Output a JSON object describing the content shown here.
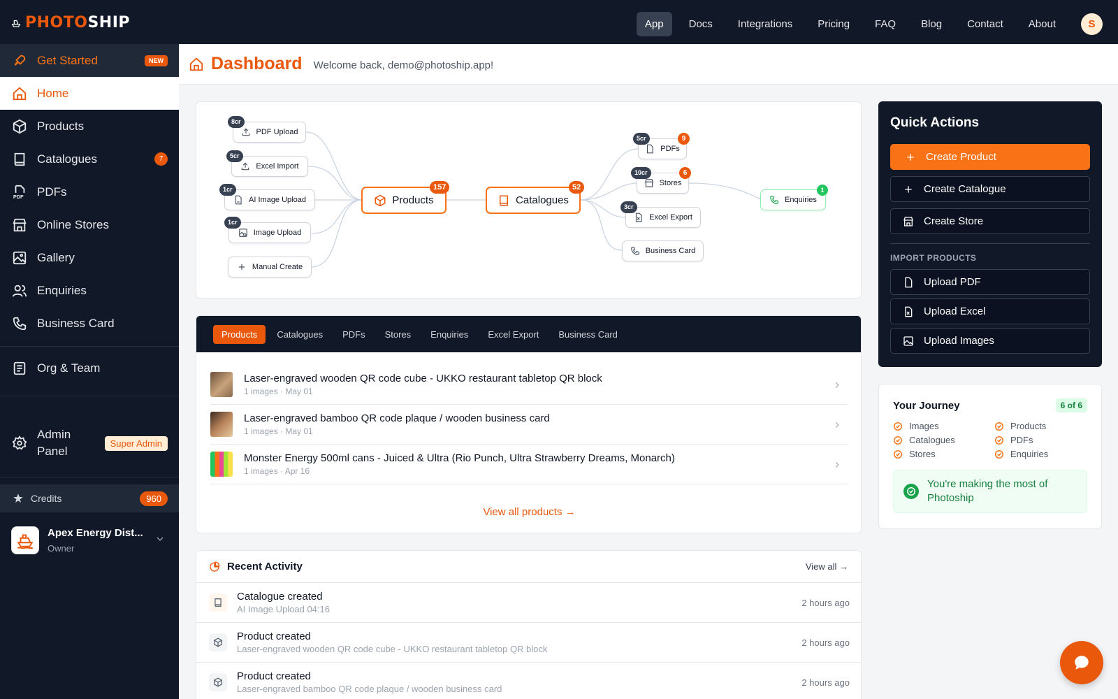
{
  "brand": {
    "part1": "PHOTO",
    "part2": "SHIP",
    "accent": "#ea580c",
    "dark": "#111827"
  },
  "topnav": {
    "items": [
      "App",
      "Docs",
      "Integrations",
      "Pricing",
      "FAQ",
      "Blog",
      "Contact",
      "About"
    ],
    "active": "App",
    "avatar_initial": "S"
  },
  "sidebar": {
    "get_started": {
      "label": "Get Started",
      "badge": "NEW"
    },
    "items": [
      {
        "label": "Home",
        "icon": "home-icon"
      },
      {
        "label": "Products",
        "icon": "cube-icon"
      },
      {
        "label": "Catalogues",
        "icon": "book-icon",
        "badge": "7"
      },
      {
        "label": "PDFs",
        "icon": "pdf-icon"
      },
      {
        "label": "Online Stores",
        "icon": "store-icon"
      },
      {
        "label": "Gallery",
        "icon": "image-icon"
      },
      {
        "label": "Enquiries",
        "icon": "users-icon"
      },
      {
        "label": "Business Card",
        "icon": "phone-icon"
      }
    ],
    "org_team": "Org & Team",
    "admin": {
      "label": "Admin Panel",
      "badge": "Super Admin"
    },
    "credits": {
      "label": "Credits",
      "value": "960"
    },
    "org": {
      "name": "Apex Energy Dist...",
      "role": "Owner"
    }
  },
  "header": {
    "title": "Dashboard",
    "welcome": "Welcome back, demo@photoship.app!"
  },
  "flow": {
    "inputs": [
      {
        "label": "PDF Upload",
        "cost": "8cr"
      },
      {
        "label": "Excel Import",
        "cost": "5cr"
      },
      {
        "label": "AI Image Upload",
        "cost": "1cr"
      },
      {
        "label": "Image Upload",
        "cost": "1cr"
      },
      {
        "label": "Manual Create",
        "cost": ""
      }
    ],
    "products": {
      "label": "Products",
      "count": "157"
    },
    "catalogues": {
      "label": "Catalogues",
      "count": "52"
    },
    "outputs": [
      {
        "label": "PDFs",
        "cost": "5cr",
        "count": "9"
      },
      {
        "label": "Stores",
        "cost": "10cr",
        "count": "6"
      },
      {
        "label": "Excel Export",
        "cost": "3cr"
      },
      {
        "label": "Business Card",
        "cost": ""
      }
    ],
    "enquiries": {
      "label": "Enquiries",
      "count": "1"
    }
  },
  "tabs": {
    "items": [
      "Products",
      "Catalogues",
      "PDFs",
      "Stores",
      "Enquiries",
      "Excel Export",
      "Business Card"
    ],
    "active": "Products",
    "products": [
      {
        "title": "Laser-engraved wooden QR code cube - UKKO restaurant tabletop QR block",
        "meta": "1 images · May 01"
      },
      {
        "title": "Laser-engraved bamboo QR code plaque / wooden business card",
        "meta": "1 images · May 01"
      },
      {
        "title": "Monster Energy 500ml cans - Juiced & Ultra (Rio Punch, Ultra Strawberry Dreams, Monarch)",
        "meta": "1 images · Apr 16"
      }
    ],
    "view_all": "View all products →"
  },
  "activity": {
    "title": "Recent Activity",
    "view_all": "View all →",
    "rows": [
      {
        "title": "Catalogue created",
        "sub": "AI Image Upload 04:16",
        "time": "2 hours ago",
        "icon": "book-icon"
      },
      {
        "title": "Product created",
        "sub": "Laser-engraved wooden QR code cube - UKKO restaurant tabletop QR block",
        "time": "2 hours ago",
        "icon": "cube-icon"
      },
      {
        "title": "Product created",
        "sub": "Laser-engraved bamboo QR code plaque / wooden business card",
        "time": "2 hours ago",
        "icon": "cube-icon"
      }
    ]
  },
  "quick_actions": {
    "title": "Quick Actions",
    "create_product": "Create Product",
    "create_catalogue": "Create Catalogue",
    "create_store": "Create Store",
    "import_heading": "IMPORT PRODUCTS",
    "upload_pdf": "Upload PDF",
    "upload_excel": "Upload Excel",
    "upload_images": "Upload Images"
  },
  "journey": {
    "title": "Your Journey",
    "badge": "6 of 6",
    "items": [
      "Images",
      "Products",
      "Catalogues",
      "PDFs",
      "Stores",
      "Enquiries"
    ],
    "done_message": "You're making the most of Photoship"
  }
}
